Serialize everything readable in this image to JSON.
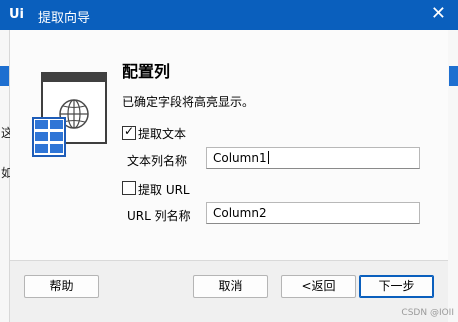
{
  "window": {
    "app_logo": "Ui",
    "title": "提取向导",
    "close_glyph": "✕"
  },
  "background": {
    "left_text_1": "这",
    "left_text_2": "如"
  },
  "header": {
    "title": "配置列",
    "description": "已确定字段将高亮显示。"
  },
  "options": {
    "extract_text": {
      "label": "提取文本",
      "checked": true,
      "column_label": "文本列名称",
      "column_value": "Column1"
    },
    "extract_url": {
      "label": "提取 URL",
      "checked": false,
      "column_label": "URL 列名称",
      "column_value": "Column2"
    }
  },
  "footer": {
    "help": "帮助",
    "cancel": "取消",
    "back": "<返回",
    "next": "下一步"
  },
  "watermark": "CSDN @IOII",
  "colors": {
    "titlebar": "#0a5fbd",
    "accent": "#1e6fd0"
  }
}
